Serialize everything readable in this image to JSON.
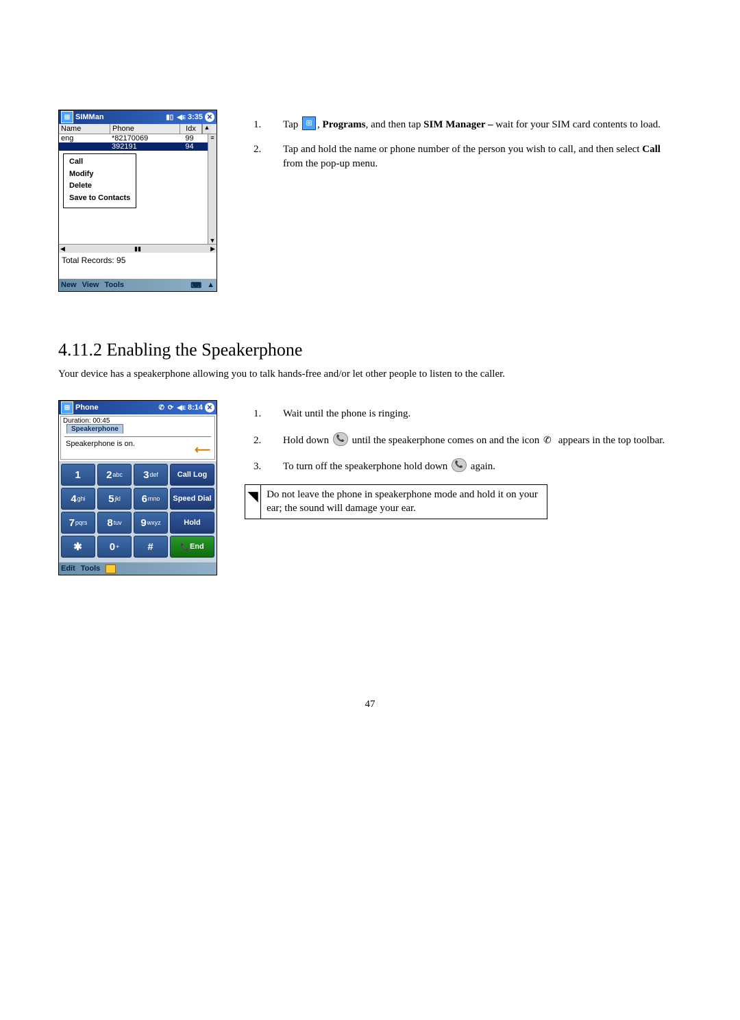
{
  "simman": {
    "titlebar": {
      "title": "SIMMan",
      "time": "3:35"
    },
    "columns": {
      "name": "Name",
      "phone": "Phone",
      "idx": "Idx"
    },
    "rows": [
      {
        "name": "eng",
        "phone": "*82170069",
        "idx": "99"
      },
      {
        "name": "",
        "phone": "392191",
        "idx": "94",
        "selected": true
      }
    ],
    "popup": [
      "Call",
      "Modify",
      "Delete",
      "Save to Contacts"
    ],
    "status": "Total Records: 95",
    "bottombar": [
      "New",
      "View",
      "Tools"
    ]
  },
  "text1": {
    "step1_a": "Tap ",
    "step1_b": ", ",
    "step1_programs": "Programs",
    "step1_c": ", and then tap ",
    "step1_sim": "SIM Manager – ",
    "step1_d": "wait for your SIM card contents to load.",
    "step2_a": "Tap and hold the name or phone number of the person you wish to call, and then select ",
    "step2_call": "Call",
    "step2_b": " from the pop-up menu."
  },
  "section": {
    "heading": "4.11.2  Enabling the Speakerphone",
    "intro": "Your device has a speakerphone allowing you to talk hands-free and/or let other people to listen to the caller."
  },
  "phone": {
    "titlebar": {
      "title": "Phone",
      "time": "8:14"
    },
    "duration": "Duration: 00:45",
    "tab": "Speakerphone",
    "msg": "Speakerphone is on.",
    "keys": {
      "k1": "1",
      "k2b": "2",
      "k2s": "abc",
      "k3b": "3",
      "k3s": "def",
      "k4b": "4",
      "k4s": "ghi",
      "k5b": "5",
      "k5s": "jkl",
      "k6b": "6",
      "k6s": "mno",
      "k7b": "7",
      "k7s": "pqrs",
      "k8b": "8",
      "k8s": "tuv",
      "k9b": "9",
      "k9s": "wxyz",
      "kst": "✱",
      "k0b": "0",
      "k0s": "+",
      "khash": "#"
    },
    "side": {
      "calllog": "Call Log",
      "speeddial": "Speed Dial",
      "hold": "Hold",
      "end": "End"
    },
    "bottombar": [
      "Edit",
      "Tools"
    ]
  },
  "text2": {
    "step1": "Wait until the phone is ringing.",
    "step2_a": "Hold down ",
    "step2_b": " until the speakerphone comes on and the icon ",
    "step2_c": " appears in the top toolbar.",
    "step3_a": "To turn off the speakerphone hold down ",
    "step3_b": " again.",
    "warn": "Do not leave the phone in speakerphone mode and hold it on your ear; the sound will damage your ear."
  },
  "pagenum": "47"
}
